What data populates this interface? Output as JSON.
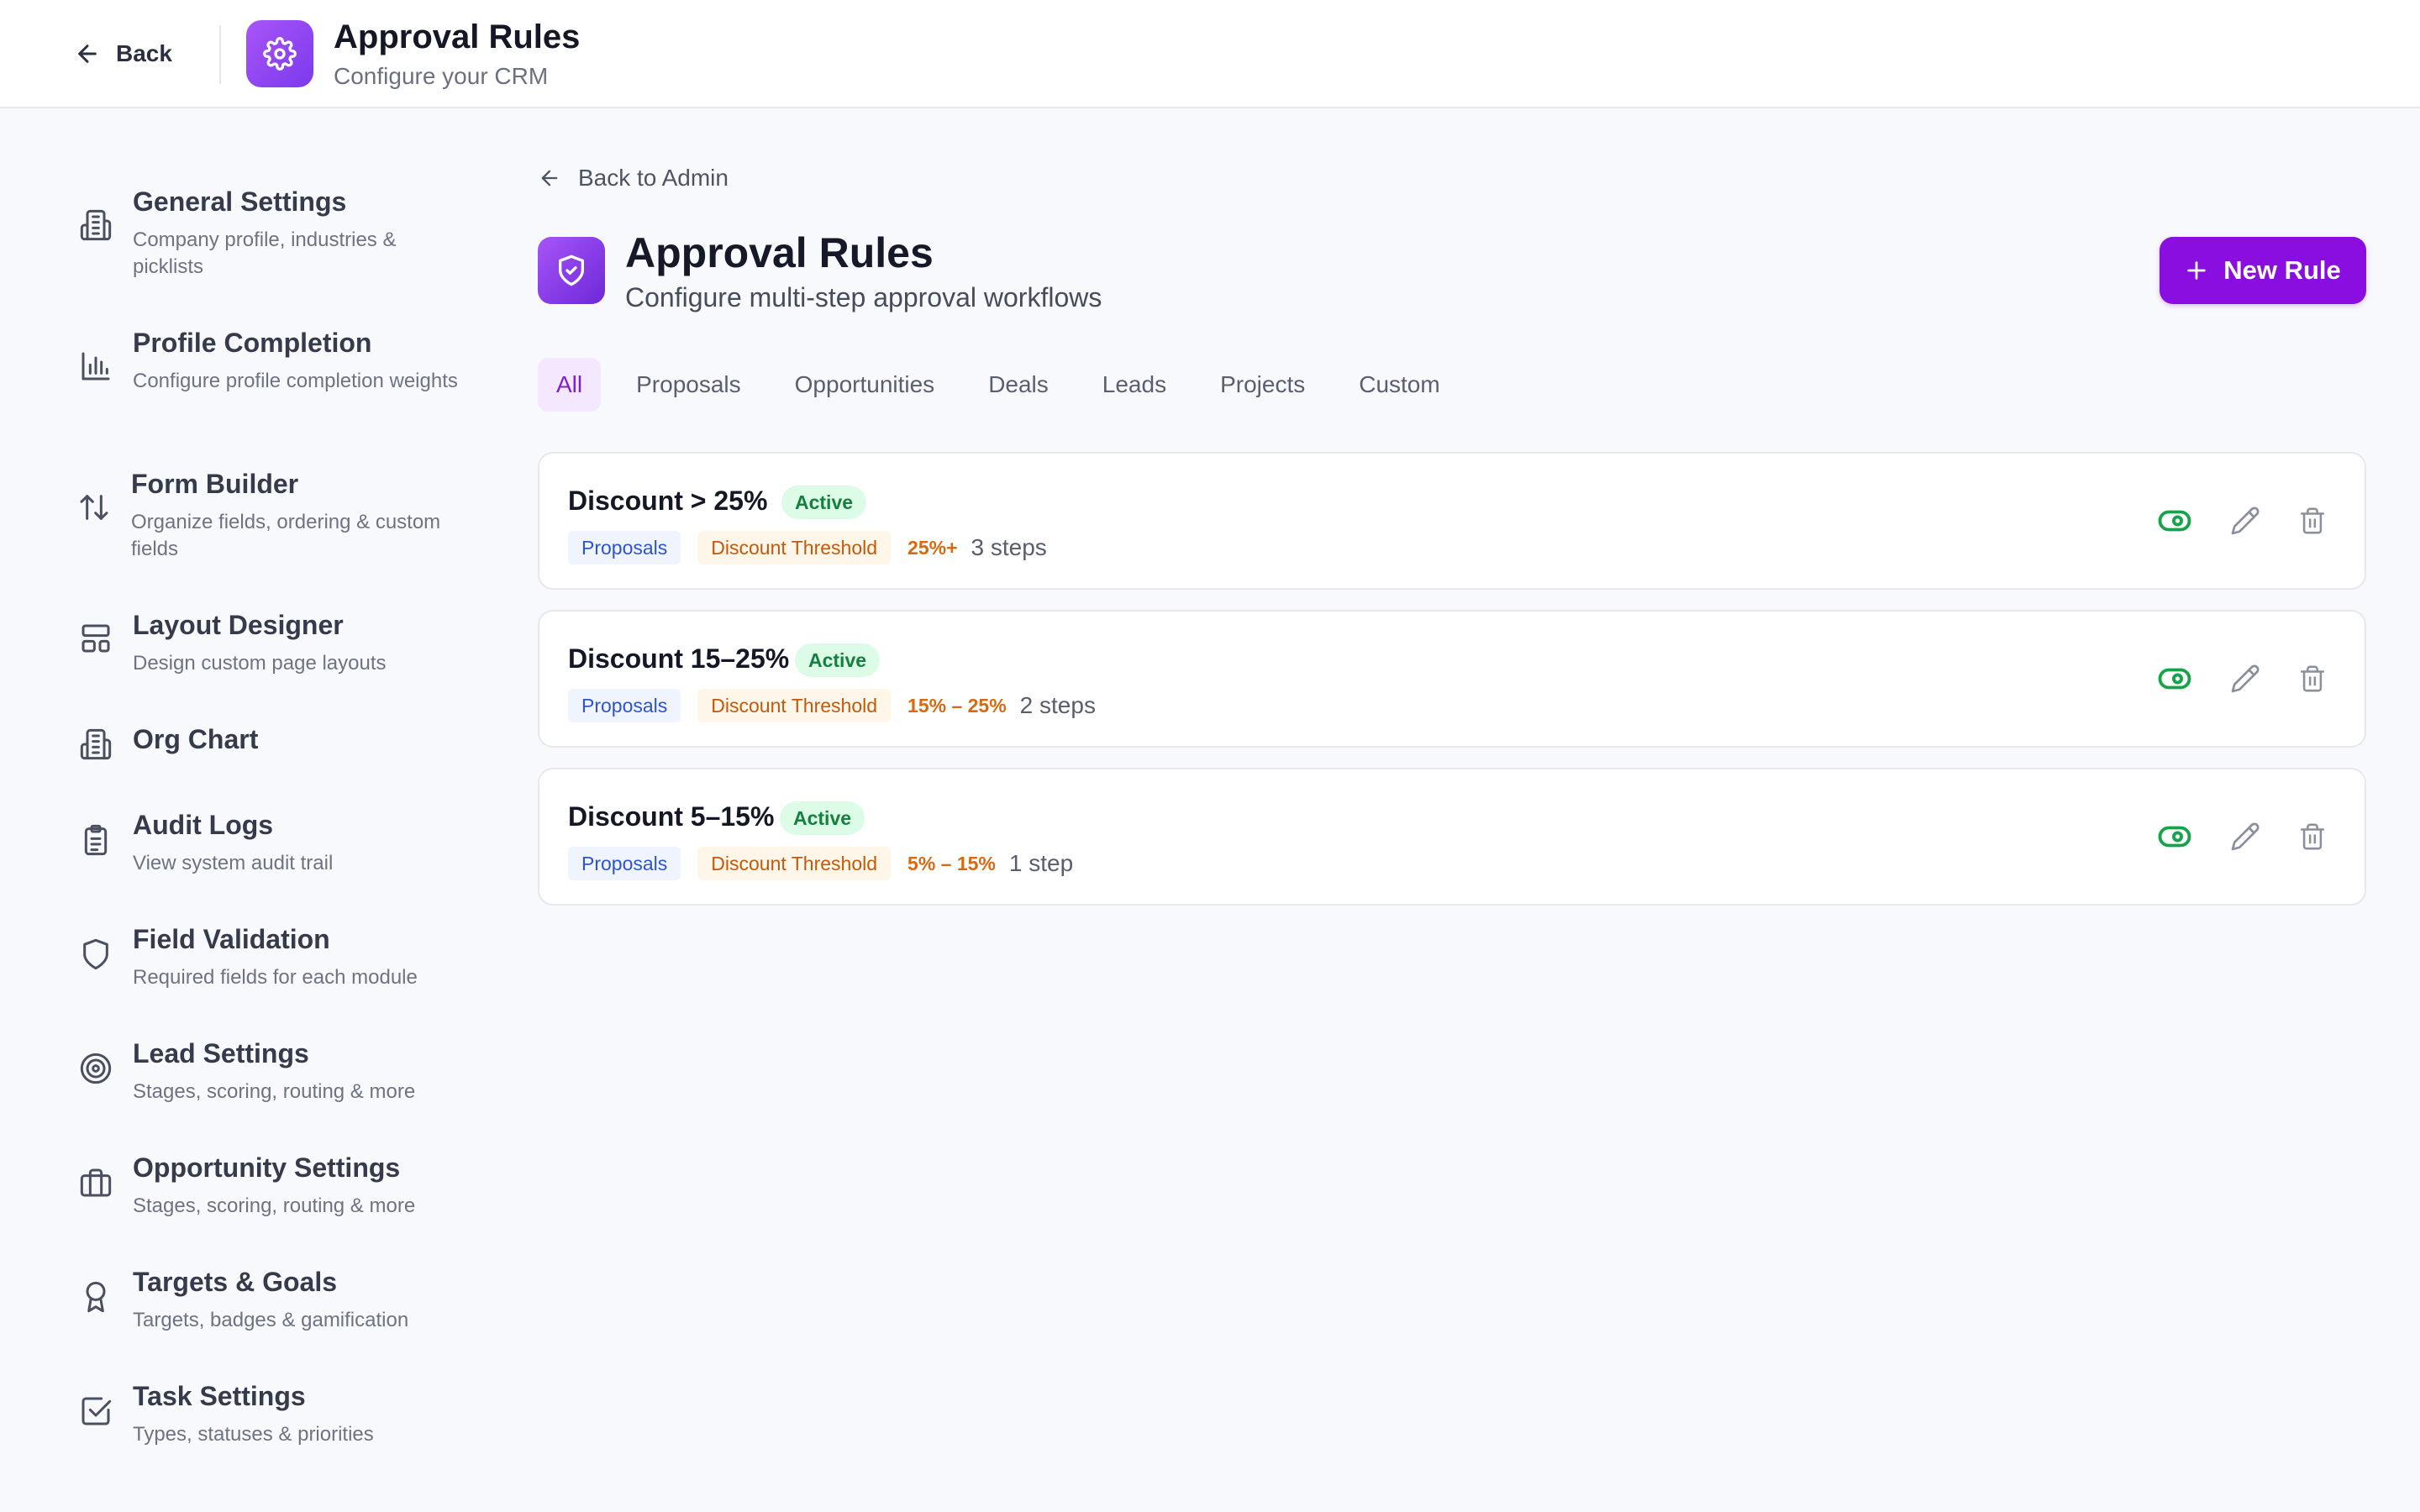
{
  "header": {
    "back_label": "Back",
    "app_icon": "gear-icon",
    "title": "Approval Rules",
    "subtitle": "Configure your CRM"
  },
  "sidebar": {
    "items": [
      {
        "icon": "building-icon",
        "title": "General Settings",
        "desc": "Company profile, industries & picklists"
      },
      {
        "icon": "bar-chart-icon",
        "title": "Profile Completion",
        "desc": "Configure profile completion weights"
      },
      {
        "icon": "sort-arrows-icon",
        "title": "Form Builder",
        "desc": "Organize fields, ordering & custom fields"
      },
      {
        "icon": "layout-icon",
        "title": "Layout Designer",
        "desc": "Design custom page layouts"
      },
      {
        "icon": "building-icon",
        "title": "Org Chart",
        "desc": ""
      },
      {
        "icon": "clipboard-icon",
        "title": "Audit Logs",
        "desc": "View system audit trail"
      },
      {
        "icon": "shield-icon",
        "title": "Field Validation",
        "desc": "Required fields for each module"
      },
      {
        "icon": "target-icon",
        "title": "Lead Settings",
        "desc": "Stages, scoring, routing & more"
      },
      {
        "icon": "briefcase-icon",
        "title": "Opportunity Settings",
        "desc": "Stages, scoring, routing & more"
      },
      {
        "icon": "award-icon",
        "title": "Targets & Goals",
        "desc": "Targets, badges & gamification"
      },
      {
        "icon": "checkbox-icon",
        "title": "Task Settings",
        "desc": "Types, statuses & priorities"
      }
    ]
  },
  "main": {
    "back_admin_label": "Back to Admin",
    "title": "Approval Rules",
    "subtitle": "Configure multi-step approval workflows",
    "new_rule_label": "New Rule",
    "tabs": [
      {
        "label": "All",
        "active": true
      },
      {
        "label": "Proposals",
        "active": false
      },
      {
        "label": "Opportunities",
        "active": false
      },
      {
        "label": "Deals",
        "active": false
      },
      {
        "label": "Leads",
        "active": false
      },
      {
        "label": "Projects",
        "active": false
      },
      {
        "label": "Custom",
        "active": false
      }
    ],
    "rules": [
      {
        "name": "Discount > 25%",
        "status": "Active",
        "module": "Proposals",
        "type": "Discount Threshold",
        "range": "25%+",
        "steps": "3 steps"
      },
      {
        "name": "Discount 15–25%",
        "status": "Active",
        "module": "Proposals",
        "type": "Discount Threshold",
        "range": "15% – 25%",
        "steps": "2 steps"
      },
      {
        "name": "Discount 5–15%",
        "status": "Active",
        "module": "Proposals",
        "type": "Discount Threshold",
        "range": "5% – 15%",
        "steps": "1 step"
      }
    ]
  },
  "colors": {
    "accent": "#8b0ee0",
    "active_green": "#16a34a",
    "tab_active_bg": "#f3e8ff",
    "chip_blue": "#2e55c9",
    "chip_orange": "#c05a0c"
  }
}
